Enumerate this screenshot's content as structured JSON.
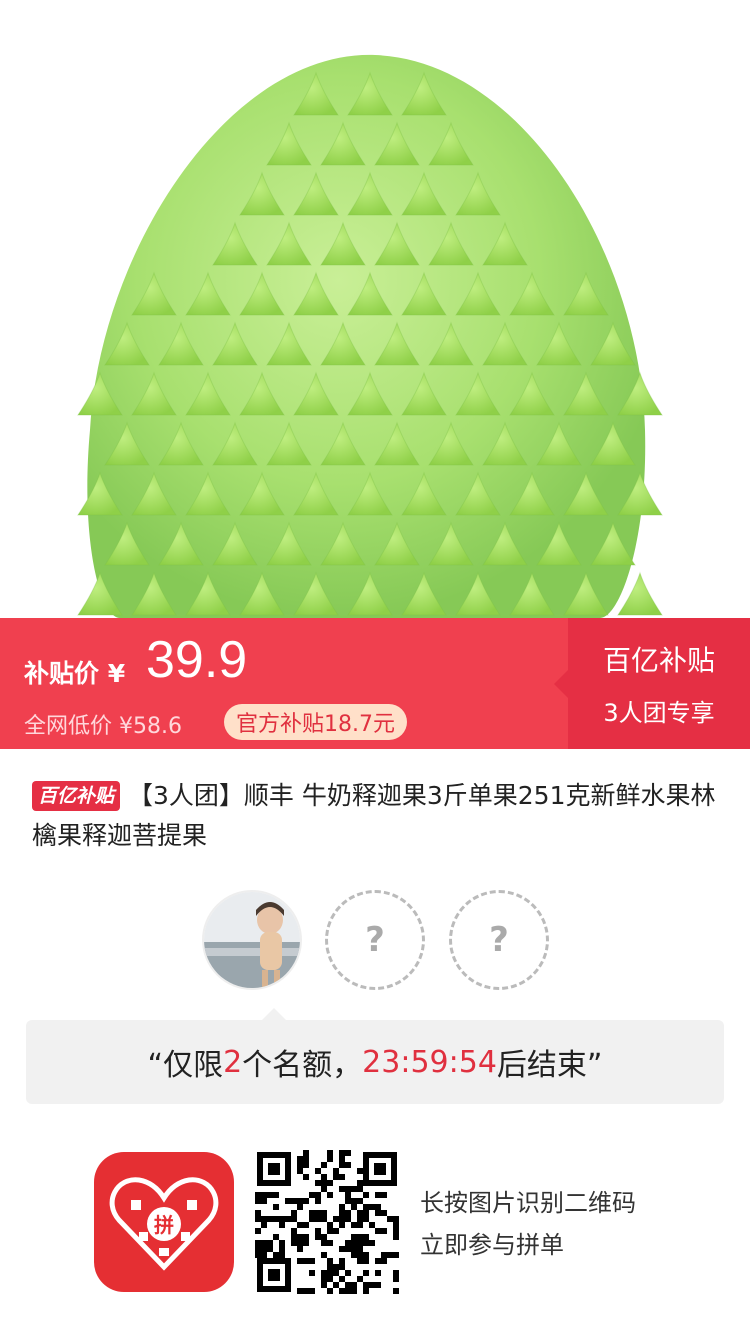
{
  "product": {
    "image": "custard-apple-fruit-image"
  },
  "price_bar": {
    "subsidy_label": "补贴价 ¥",
    "price": "39.9",
    "original_price": "全网低价 ¥58.6",
    "subsidy_amount": "官方补贴18.7元",
    "badge_title": "百亿补贴",
    "badge_sub": "3人团专享"
  },
  "title": {
    "tag": "百亿补贴",
    "text": "【3人团】顺丰 牛奶释迦果3斤单果251克新鲜水果林檎果释迦菩提果"
  },
  "group": {
    "empty_slot": "?"
  },
  "quota": {
    "prefix": "“仅限",
    "count": "2",
    "mid": "个名额，",
    "timer": "23:59:54",
    "suffix": "后结束”"
  },
  "footer": {
    "logo_text": "拼",
    "hint_line1": "长按图片识别二维码",
    "hint_line2": "立即参与拼单"
  },
  "colors": {
    "primary_red": "#f0404f",
    "dark_red": "#e52f44",
    "fruit_green": "#9fdc6a"
  }
}
